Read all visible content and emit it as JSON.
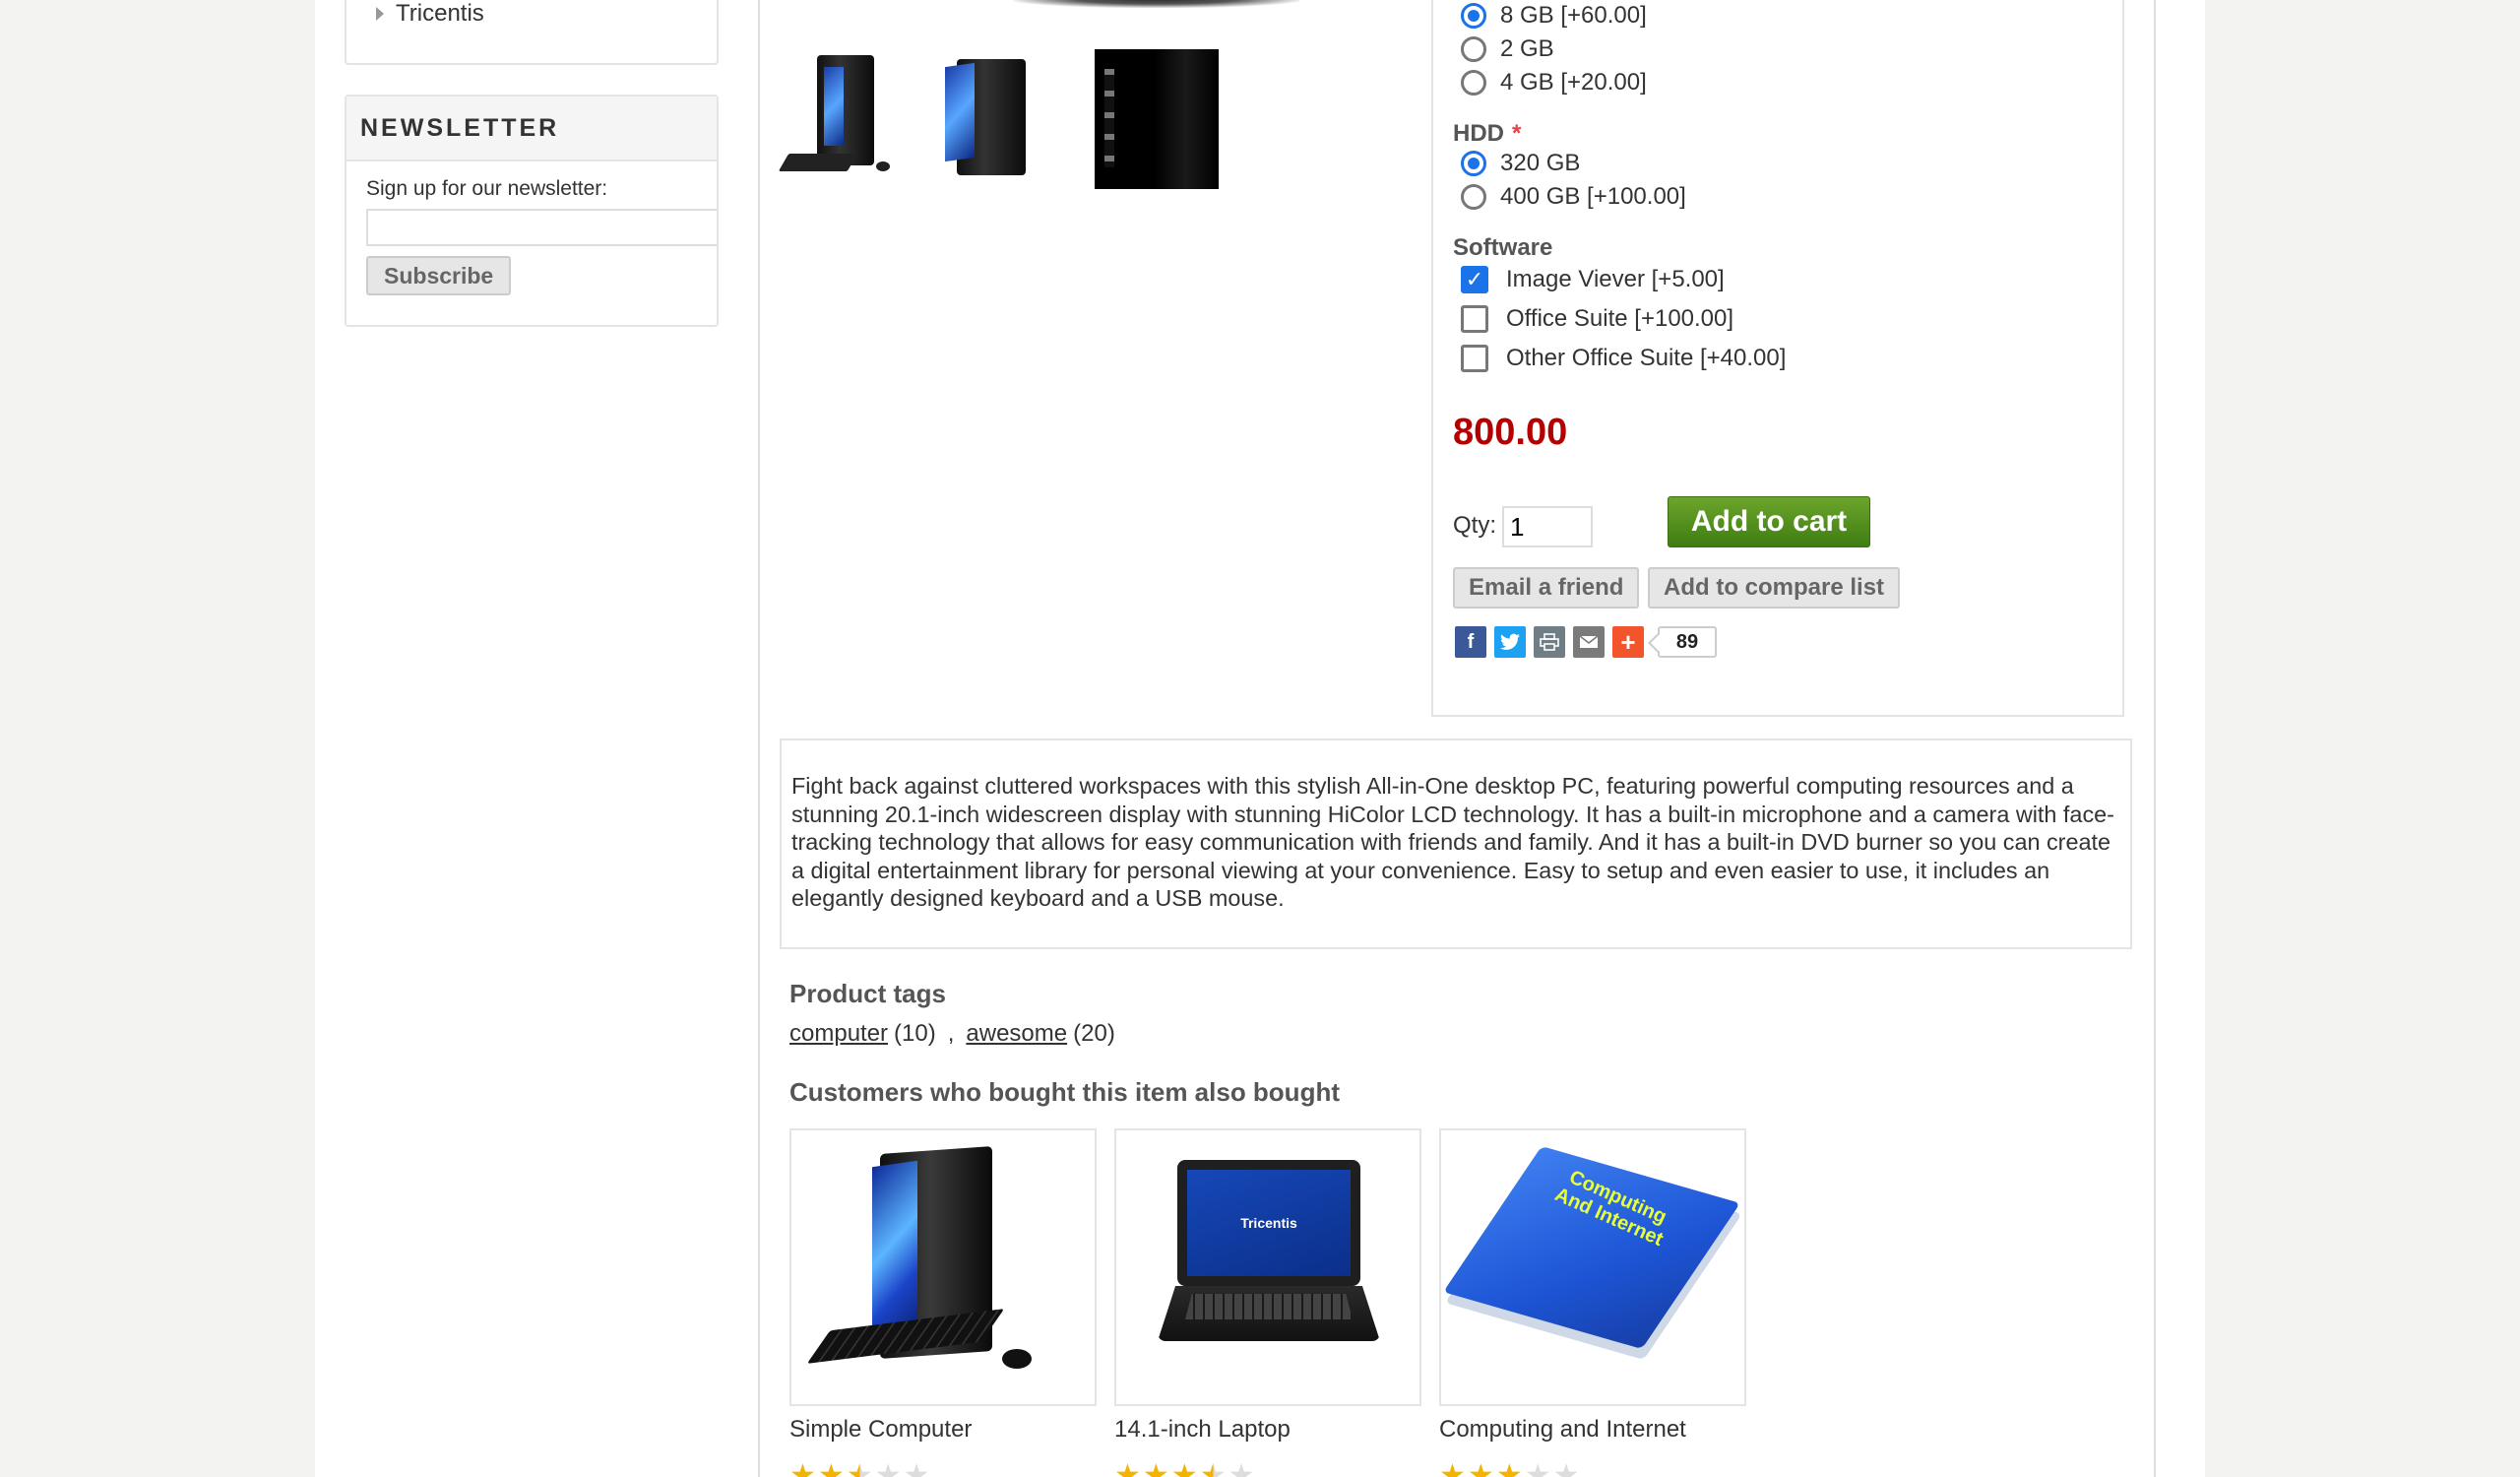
{
  "sidebar": {
    "category_item": "Tricentis",
    "newsletter": {
      "title": "NEWSLETTER",
      "label": "Sign up for our newsletter:",
      "email_value": "",
      "subscribe_label": "Subscribe"
    }
  },
  "product": {
    "ram_options": [
      {
        "label": "8 GB [+60.00]",
        "selected": true
      },
      {
        "label": "2 GB",
        "selected": false
      },
      {
        "label": "4 GB [+20.00]",
        "selected": false
      }
    ],
    "hdd": {
      "label": "HDD",
      "required_marker": "*",
      "options": [
        {
          "label": "320 GB",
          "selected": true
        },
        {
          "label": "400 GB [+100.00]",
          "selected": false
        }
      ]
    },
    "software": {
      "label": "Software",
      "options": [
        {
          "label": "Image Viever [+5.00]",
          "checked": true
        },
        {
          "label": "Office Suite [+100.00]",
          "checked": false
        },
        {
          "label": "Other Office Suite [+40.00]",
          "checked": false
        }
      ]
    },
    "price": "800.00",
    "qty_label": "Qty:",
    "qty_value": "1",
    "add_to_cart_label": "Add to cart",
    "email_friend_label": "Email a friend",
    "compare_label": "Add to compare list",
    "share": {
      "icons": [
        "facebook-icon",
        "twitter-icon",
        "print-icon",
        "email-icon",
        "plus-icon"
      ],
      "count": "89"
    },
    "description": "Fight back against cluttered workspaces with this stylish All-in-One desktop PC, featuring powerful computing resources and a stunning 20.1-inch widescreen display with stunning HiColor LCD technology. It has a built-in microphone and a camera with face-tracking technology that allows for easy communication with friends and family. And it has a built-in DVD burner so you can create a digital entertainment library for personal viewing at your convenience. Easy to setup and even easier to use, it includes an elegantly designed keyboard and a USB mouse.",
    "tags_title": "Product tags",
    "tags": [
      {
        "name": "computer",
        "count": "(10)"
      },
      {
        "name": "awesome",
        "count": "(20)"
      }
    ],
    "tag_separator": ",",
    "also_bought_title": "Customers who bought this item also bought",
    "also_bought": [
      {
        "name": "Simple Computer",
        "rating": 2.5
      },
      {
        "name": "14.1-inch Laptop",
        "rating": 3.5
      },
      {
        "name": "Computing and Internet",
        "rating": 3
      },
      {
        "book_cover_text": "Computing And Internet",
        "laptop_brand": "Tricentis"
      }
    ]
  },
  "colors": {
    "price": "#b40000",
    "cart_green": "#4e8f1c",
    "accent_blue": "#1a73e8",
    "facebook": "#3b5998",
    "twitter": "#1da1f2",
    "plus": "#f2552c"
  }
}
